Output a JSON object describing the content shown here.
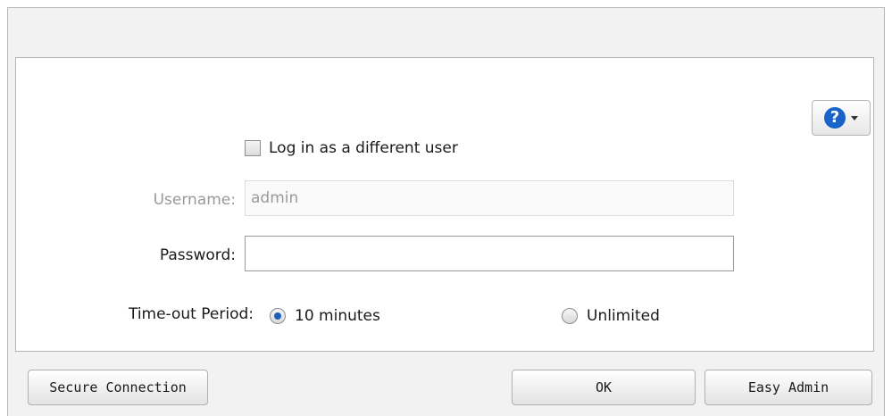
{
  "help": {
    "icon_glyph": "?"
  },
  "login": {
    "different_user_label": "Log in as a different user",
    "different_user_checked": false
  },
  "fields": {
    "username_label": "Username:",
    "username_value": "admin",
    "password_label": "Password:",
    "password_value": ""
  },
  "timeout": {
    "label": "Time-out Period:",
    "options": [
      "10 minutes",
      "Unlimited"
    ],
    "selected": "10 minutes"
  },
  "buttons": {
    "secure_connection": "Secure Connection",
    "ok": "OK",
    "easy_admin": "Easy Admin"
  },
  "colors": {
    "accent": "#1a63c8",
    "dialog_bg": "#f2f2f2",
    "panel_bg": "#ffffff",
    "disabled_text": "#9a9a9a"
  }
}
